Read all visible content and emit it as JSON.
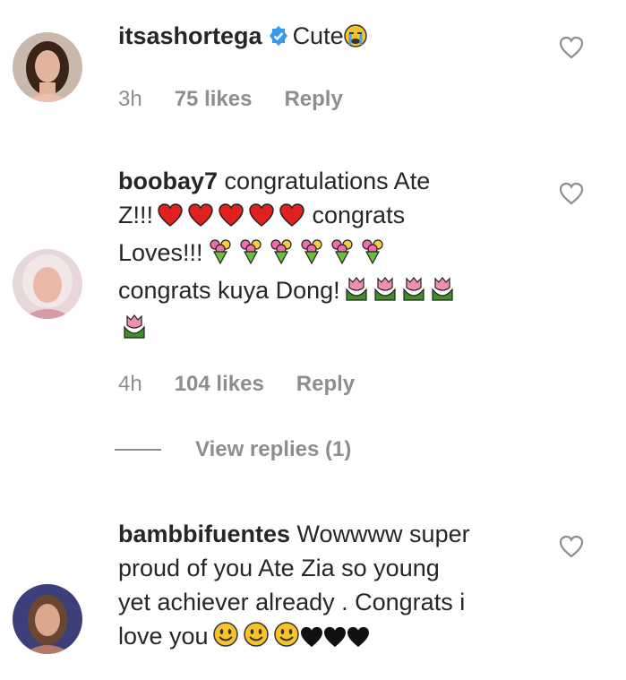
{
  "comments": [
    {
      "username": "itsashortega",
      "verified": true,
      "text": "Cute",
      "time": "3h",
      "likes": "75 likes",
      "reply": "Reply"
    },
    {
      "username": "boobay7",
      "verified": false,
      "text_line1": "congratulations Ate",
      "text_z": "Z!!!",
      "text_congrats": "congrats",
      "text_loves": "Loves!!!",
      "text_kuya": "congrats kuya Dong!",
      "time": "4h",
      "likes": "104 likes",
      "reply": "Reply",
      "view_replies": "View replies (1)"
    },
    {
      "username": "bambbifuentes",
      "verified": false,
      "text_line1": "Wowwww super",
      "text_line2": "proud of you Ate Zia so young",
      "text_line3": "yet achiever already . Congrats i",
      "text_line4": "love you"
    }
  ],
  "icons": {
    "like": "heart-outline-icon",
    "verified": "verified-badge-icon"
  },
  "colors": {
    "text": "#262626",
    "muted": "#8e8e8e",
    "verified": "#3897f0",
    "heart_emoji": "#e0211f"
  }
}
